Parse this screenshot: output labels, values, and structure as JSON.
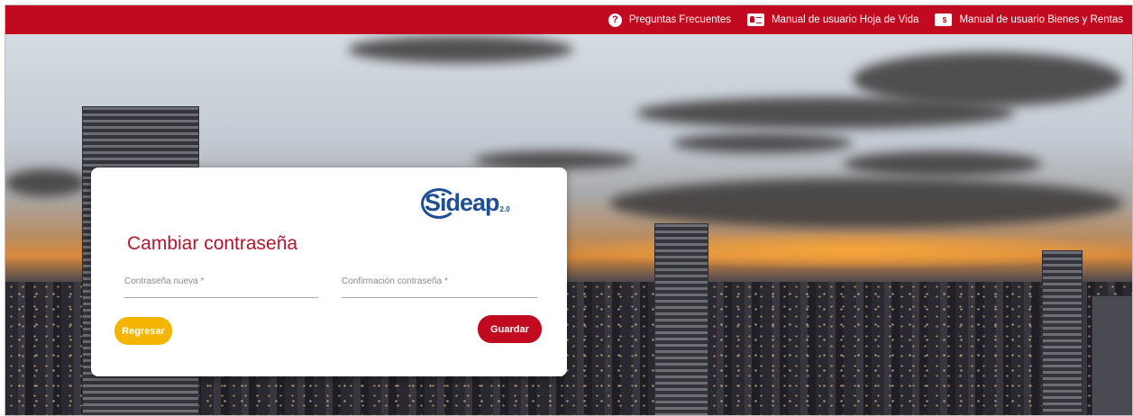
{
  "topbar": {
    "links": [
      {
        "label": "Preguntas Frecuentes",
        "icon": "question-circle-icon"
      },
      {
        "label": "Manual de usuario Hoja de Vida",
        "icon": "id-card-icon"
      },
      {
        "label": "Manual de usuario Bienes y Rentas",
        "icon": "money-icon"
      }
    ],
    "icon_glyphs": {
      "question": "?",
      "money": "$"
    }
  },
  "card": {
    "logo": {
      "text": "Sideap",
      "version": "2.0"
    },
    "title": "Cambiar contraseña",
    "fields": {
      "new_password": {
        "placeholder": "Contraseña nueva *",
        "value": ""
      },
      "confirm_password": {
        "placeholder": "Confirmación contraseña *",
        "value": ""
      }
    },
    "back_label": "Regresar",
    "save_label": "Guardar"
  },
  "colors": {
    "brand_red": "#c1091f",
    "back_yellow": "#f4b400",
    "logo_blue": "#1f4e95",
    "title_red": "#b0162c"
  }
}
